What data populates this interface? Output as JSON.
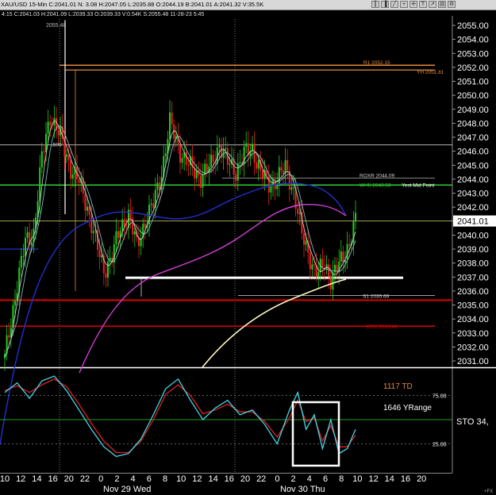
{
  "quote": {
    "header_line": "XAU/USD 15-Min C:2041.01 N: 3.08 H:2047.05 L:2035.88 O:2044.19 B:2041.01 A:2041.32 V:35.5K",
    "sub_line": "4:15 C:2041.03 H:2041.09 L:2039.33 O:2039.33 V:0.54K S:2055.48 11-28-23 5:45"
  },
  "toolbar": {
    "icons": [
      "bar-icon",
      "candle-icon",
      "line-icon",
      "zoom-icon",
      "cross-icon",
      "text-icon",
      "trend-icon",
      "print-icon",
      "settings-icon"
    ]
  },
  "colors": {
    "background": "#000000",
    "up_candle": "#22cc22",
    "down_candle": "#ee2222",
    "pivot_orange": "#e08a3c",
    "green_line": "#2fd02f",
    "magenta_ma": "#d040d0",
    "blue_ma": "#2030d0",
    "cream_ma": "#fff7c0",
    "red_support": "#e00000",
    "price_tag": "#ffffff"
  },
  "chart_data": [
    {
      "type": "line",
      "title": "XAU/USD 15-Min",
      "price_axis": {
        "ylim": [
          2030.5,
          2055.6
        ],
        "ticks": [
          "2031.00",
          "2032.00",
          "2033.00",
          "2034.00",
          "2035.00",
          "2036.00",
          "2037.00",
          "2038.00",
          "2039.00",
          "2040.00",
          "2041.00",
          "2042.00",
          "2043.00",
          "2044.00",
          "2045.00",
          "2046.00",
          "2047.00",
          "2048.00",
          "2049.00",
          "2050.00",
          "2051.00",
          "2052.00",
          "2053.00",
          "2054.00",
          "2055.00"
        ],
        "last_price": "2041.01"
      },
      "x_ticks": [
        "10",
        "12",
        "14",
        "16",
        "20",
        "22",
        "0",
        "2",
        "4",
        "6",
        "8",
        "10",
        "12",
        "14",
        "16",
        "20",
        "22",
        "0",
        "2",
        "4",
        "6",
        "8",
        "10",
        "12",
        "14",
        "16",
        "20"
      ],
      "date_labels": [
        "Nov 29 Wed",
        "Nov 30 Thu"
      ],
      "close_series": {
        "x_bars": [
          0,
          6,
          10,
          14,
          18,
          22,
          27,
          32,
          36,
          40,
          45,
          48,
          52,
          56,
          60,
          64,
          68,
          72,
          76,
          80,
          85,
          90,
          95,
          100,
          104,
          108,
          112,
          116,
          120,
          124,
          128,
          132,
          136,
          140,
          144,
          148,
          150,
          152,
          155,
          158,
          161,
          164,
          167,
          170
        ],
        "values": [
          2031.2,
          2036.5,
          2039.5,
          2040.2,
          2045.5,
          2048.6,
          2047.0,
          2044.8,
          2043.8,
          2042.0,
          2039.0,
          2037.5,
          2038.5,
          2040.5,
          2041.5,
          2039.2,
          2041.0,
          2042.2,
          2044.5,
          2048.0,
          2046.0,
          2044.8,
          2044.2,
          2045.0,
          2046.5,
          2045.2,
          2044.6,
          2045.8,
          2046.2,
          2044.5,
          2043.6,
          2044.0,
          2044.8,
          2043.2,
          2040.0,
          2038.4,
          2037.5,
          2037.2,
          2038.0,
          2036.9,
          2037.6,
          2038.4,
          2039.5,
          2041.0
        ]
      },
      "pivot_levels": [
        {
          "label": "R1 2052.15",
          "value": 2052.15
        },
        {
          "label": "YH 2051.81",
          "value": 2051.81
        },
        {
          "label": "ROXR 2044.09",
          "value": 2044.09
        },
        {
          "label": "WH5 2043.58",
          "value": 2043.58
        },
        {
          "label": "Yest Mid Point",
          "value": 2043.58
        },
        {
          "label": "S1 2035.69",
          "value": 2035.69
        },
        {
          "label": "WR2 2033.49",
          "value": 2033.49
        }
      ],
      "other_labels": {
        "high_mark": "2055.48",
        "fib_label": ".500"
      },
      "support_line_value": 2036.95,
      "red_support_value": 2035.35
    },
    {
      "type": "line",
      "title": "STO 34",
      "indicator_label": "STO 34,",
      "ylim": [
        0,
        100
      ],
      "ticks": [
        "75.00",
        "25.00"
      ],
      "annotations": [
        "1117 TD",
        "1646 YRange"
      ],
      "x_bars": [
        0,
        6,
        12,
        18,
        24,
        30,
        36,
        42,
        48,
        54,
        60,
        66,
        72,
        78,
        84,
        90,
        96,
        102,
        108,
        114,
        120,
        126,
        132,
        138,
        142,
        146,
        150,
        154,
        158,
        162,
        166,
        170
      ],
      "fast": [
        78,
        88,
        72,
        90,
        95,
        80,
        60,
        40,
        22,
        12,
        15,
        30,
        55,
        82,
        92,
        70,
        50,
        62,
        70,
        55,
        60,
        45,
        25,
        60,
        78,
        40,
        55,
        20,
        50,
        15,
        20,
        40
      ],
      "slow": [
        80,
        85,
        78,
        86,
        92,
        84,
        66,
        46,
        28,
        16,
        16,
        28,
        50,
        76,
        86,
        75,
        56,
        60,
        66,
        58,
        58,
        48,
        32,
        52,
        70,
        48,
        52,
        28,
        44,
        22,
        22,
        34
      ]
    }
  ]
}
